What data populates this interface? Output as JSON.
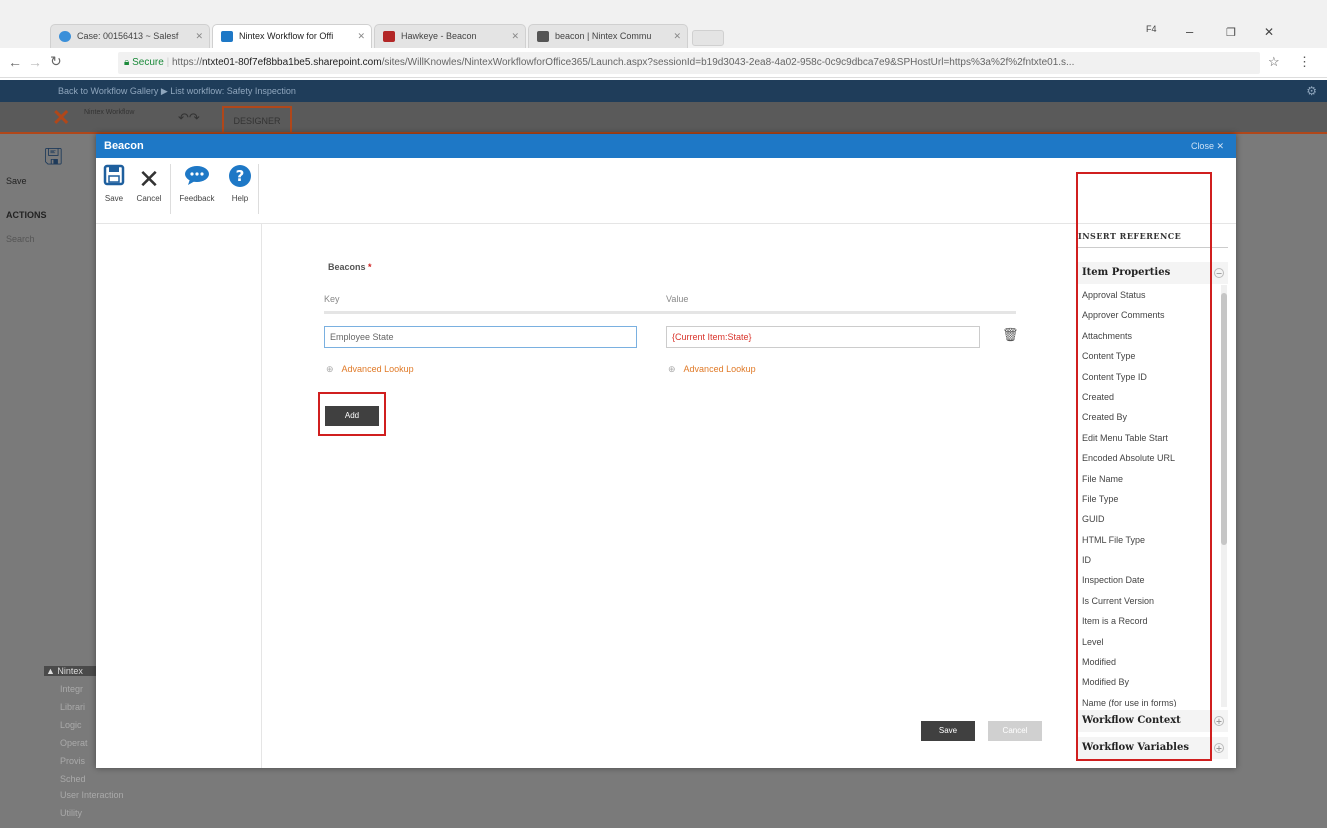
{
  "browser": {
    "window_title": "F4",
    "tabs": [
      {
        "label": "Case: 00156413 ~ Salesf",
        "color": "#3a8fd9"
      },
      {
        "label": "Nintex Workflow for Offi",
        "color": "#1e78c6"
      },
      {
        "label": "Hawkeye - Beacon",
        "color": "#b32727"
      },
      {
        "label": "beacon | Nintex Commu",
        "color": "#555555"
      }
    ],
    "secure_label": "Secure",
    "url_prefix": "https://",
    "url_host": "ntxte01-80f7ef8bba1be5.sharepoint.com",
    "url_path": "/sites/WillKnowles/NintexWorkflowforOffice365/Launch.aspx?sessionId=b19d3043-2ea8-4a02-958c-0c9c9dbca7e9&SPHostUrl=https%3a%2f%2fntxte01.s..."
  },
  "background_app": {
    "breadcrumb": "Back to Workflow Gallery  ▶  List workflow: Safety Inspection",
    "logo_text": "Nintex Workflow",
    "designer_tab": "DESIGNER",
    "save_label": "Save",
    "actions_label": "ACTIONS",
    "search_label": "Search",
    "bottom_items": [
      "▲ Nintex",
      "Integr",
      "Librari",
      "Logic",
      "Operat",
      "Provis",
      "Sched",
      "User Interaction",
      "Utility"
    ]
  },
  "dialog": {
    "title": "Beacon",
    "close_label": "Close ✕",
    "ribbon": {
      "save": "Save",
      "cancel": "Cancel",
      "feedback": "Feedback",
      "help": "Help"
    },
    "form": {
      "section_label": "Beacons",
      "required_mark": "*",
      "key_header": "Key",
      "value_header": "Value",
      "key_value": "Employee State",
      "value_value": "{Current Item:State}",
      "lookup_label": "Advanced Lookup",
      "add_label": "Add"
    },
    "footer": {
      "save": "Save",
      "cancel": "Cancel"
    },
    "insert_reference": {
      "heading": "INSERT REFERENCE",
      "item_properties": "Item Properties",
      "items": [
        "Approval Status",
        "Approver Comments",
        "Attachments",
        "Content Type",
        "Content Type ID",
        "Created",
        "Created By",
        "Edit Menu Table Start",
        "Encoded Absolute URL",
        "File Name",
        "File Type",
        "GUID",
        "HTML File Type",
        "ID",
        "Inspection Date",
        "Is Current Version",
        "Item is a Record",
        "Level",
        "Modified",
        "Modified By",
        "Name (for use in forms)"
      ],
      "workflow_context": "Workflow Context",
      "workflow_variables": "Workflow Variables"
    }
  },
  "colors": {
    "accent": "#1e78c6",
    "highlight": "#d01f1f",
    "link": "#e07a28",
    "value_text": "#d9342b"
  }
}
